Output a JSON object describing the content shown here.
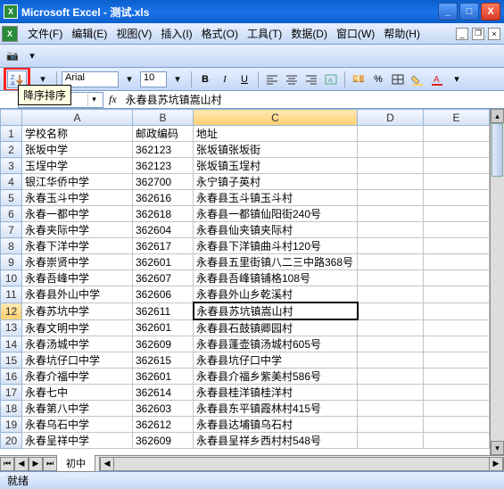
{
  "window": {
    "title": "Microsoft Excel - 测试.xls",
    "min": "_",
    "max": "□",
    "close": "X"
  },
  "menus": {
    "file": "文件(F)",
    "edit": "编辑(E)",
    "view": "视图(V)",
    "insert": "插入(I)",
    "format": "格式(O)",
    "tools": "工具(T)",
    "data": "数据(D)",
    "window": "窗口(W)",
    "help": "帮助(H)"
  },
  "toolbar": {
    "font_name": "Arial",
    "font_size": "10",
    "bold": "B",
    "italic": "I",
    "underline": "U"
  },
  "tooltip": "降序排序",
  "namebox": "",
  "fx_label": "fx",
  "formula": "永春县苏坑镇嵩山村",
  "columns": [
    "A",
    "B",
    "C",
    "D",
    "E"
  ],
  "rows": [
    {
      "n": "1",
      "a": "学校名称",
      "b": "邮政编码",
      "c": "地址"
    },
    {
      "n": "2",
      "a": "张坂中学",
      "b": "362123",
      "c": "张坂镇张坂街"
    },
    {
      "n": "3",
      "a": "玉埕中学",
      "b": "362123",
      "c": "张坂镇玉埕村"
    },
    {
      "n": "4",
      "a": "银江华侨中学",
      "b": "362700",
      "c": "永宁镇子英村"
    },
    {
      "n": "5",
      "a": "永春玉斗中学",
      "b": "362616",
      "c": "永春县玉斗镇玉斗村"
    },
    {
      "n": "6",
      "a": "永春一都中学",
      "b": "362618",
      "c": "永春县一都镇仙阳街240号"
    },
    {
      "n": "7",
      "a": "永春夹际中学",
      "b": "362604",
      "c": "永春县仙夹镇夹际村"
    },
    {
      "n": "8",
      "a": "永春下洋中学",
      "b": "362617",
      "c": "永春县下洋镇曲斗村120号"
    },
    {
      "n": "9",
      "a": "永春崇贤中学",
      "b": "362601",
      "c": "永春县五里街镇八二三中路368号"
    },
    {
      "n": "10",
      "a": "永春吾峰中学",
      "b": "362607",
      "c": "永春县吾峰镇铺格108号"
    },
    {
      "n": "11",
      "a": "永春县外山中学",
      "b": "362606",
      "c": "永春县外山乡乾溪村"
    },
    {
      "n": "12",
      "a": "永春苏坑中学",
      "b": "362611",
      "c": "永春县苏坑镇嵩山村"
    },
    {
      "n": "13",
      "a": "永春文明中学",
      "b": "362601",
      "c": "永春县石鼓镇卿园村"
    },
    {
      "n": "14",
      "a": "永春汤城中学",
      "b": "362609",
      "c": "永春县蓬壶镇汤城村605号"
    },
    {
      "n": "15",
      "a": "永春坑仔口中学",
      "b": "362615",
      "c": "永春县坑仔口中学"
    },
    {
      "n": "16",
      "a": "永春介福中学",
      "b": "362601",
      "c": "永春县介福乡紫美村586号"
    },
    {
      "n": "17",
      "a": "永春七中",
      "b": "362614",
      "c": "永春县桂洋镇桂洋村"
    },
    {
      "n": "18",
      "a": "永春第八中学",
      "b": "362603",
      "c": "永春县东平镇霞林村415号"
    },
    {
      "n": "19",
      "a": "永春乌石中学",
      "b": "362612",
      "c": "永春县达埔镇乌石村"
    },
    {
      "n": "20",
      "a": "永春呈祥中学",
      "b": "362609",
      "c": "永春县呈祥乡西村村548号"
    }
  ],
  "selected": {
    "row": 12,
    "col": "C"
  },
  "sheet_tabs": {
    "active": "初中"
  },
  "status": "就绪"
}
